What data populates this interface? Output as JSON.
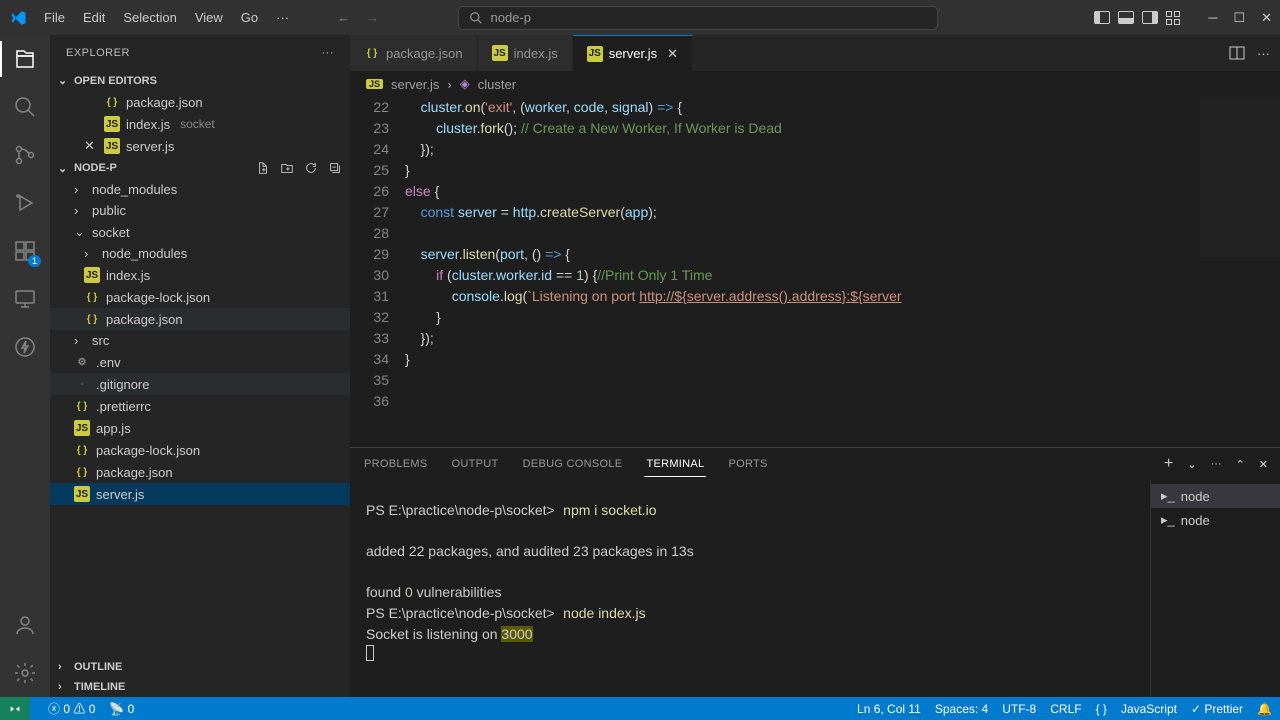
{
  "titlebar": {
    "menu": [
      "File",
      "Edit",
      "Selection",
      "View",
      "Go",
      "···"
    ],
    "search": "node-p"
  },
  "sidebar": {
    "title": "EXPLORER",
    "open_editors": {
      "label": "OPEN EDITORS",
      "items": [
        {
          "icon": "json",
          "name": "package.json",
          "closable": false
        },
        {
          "icon": "js",
          "name": "index.js",
          "desc": "socket",
          "closable": false
        },
        {
          "icon": "js",
          "name": "server.js",
          "closable": true
        }
      ]
    },
    "project": {
      "label": "NODE-P",
      "tree": [
        {
          "type": "folder",
          "name": "node_modules",
          "indent": 0,
          "open": false
        },
        {
          "type": "folder",
          "name": "public",
          "indent": 0,
          "open": false
        },
        {
          "type": "folder",
          "name": "socket",
          "indent": 0,
          "open": true
        },
        {
          "type": "folder",
          "name": "node_modules",
          "indent": 1,
          "open": false
        },
        {
          "type": "file",
          "icon": "js",
          "name": "index.js",
          "indent": 1
        },
        {
          "type": "file",
          "icon": "json",
          "name": "package-lock.json",
          "indent": 1
        },
        {
          "type": "file",
          "icon": "json",
          "name": "package.json",
          "indent": 1,
          "hover": true
        },
        {
          "type": "folder",
          "name": "src",
          "indent": 0,
          "open": false
        },
        {
          "type": "file",
          "icon": "gear",
          "name": ".env",
          "indent": 0
        },
        {
          "type": "file",
          "icon": "none",
          "name": ".gitignore",
          "indent": 0,
          "hover2": true
        },
        {
          "type": "file",
          "icon": "json",
          "name": ".prettierrc",
          "indent": 0
        },
        {
          "type": "file",
          "icon": "js",
          "name": "app.js",
          "indent": 0
        },
        {
          "type": "file",
          "icon": "json",
          "name": "package-lock.json",
          "indent": 0
        },
        {
          "type": "file",
          "icon": "json",
          "name": "package.json",
          "indent": 0
        },
        {
          "type": "file",
          "icon": "js",
          "name": "server.js",
          "indent": 0,
          "selected": true
        }
      ]
    },
    "outline": "OUTLINE",
    "timeline": "TIMELINE"
  },
  "editor": {
    "tabs": [
      {
        "icon": "json",
        "name": "package.json"
      },
      {
        "icon": "js",
        "name": "index.js"
      },
      {
        "icon": "js",
        "name": "server.js",
        "active": true,
        "closable": true
      }
    ],
    "breadcrumb": {
      "file": "server.js",
      "symbol": "cluster"
    },
    "lines": [
      22,
      23,
      24,
      25,
      26,
      27,
      28,
      29,
      30,
      31,
      32,
      33,
      34,
      35,
      36
    ]
  },
  "panel": {
    "tabs": [
      "PROBLEMS",
      "OUTPUT",
      "DEBUG CONSOLE",
      "TERMINAL",
      "PORTS"
    ],
    "active_tab": "TERMINAL",
    "terminals": [
      "node",
      "node"
    ],
    "output": {
      "line1_prompt": "PS E:\\practice\\node-p\\socket>",
      "line1_cmd": "npm i socket.io",
      "line2": "added 22 packages, and audited 23 packages in 13s",
      "line3a": "found ",
      "line3b": "0",
      "line3c": " vulnerabilities",
      "line4_prompt": "PS E:\\practice\\node-p\\socket>",
      "line4_cmd": "node index.js",
      "line5a": "Socket is listening on ",
      "line5b": "3000"
    }
  },
  "statusbar": {
    "remote": "⌘",
    "errors": "0",
    "warnings": "0",
    "ports": "0",
    "pos": "Ln 6, Col 11",
    "spaces": "Spaces: 4",
    "enc": "UTF-8",
    "eol": "CRLF",
    "lang_icon": "{ }",
    "lang": "JavaScript",
    "prettier": "Prettier"
  },
  "activity_badge": "1"
}
